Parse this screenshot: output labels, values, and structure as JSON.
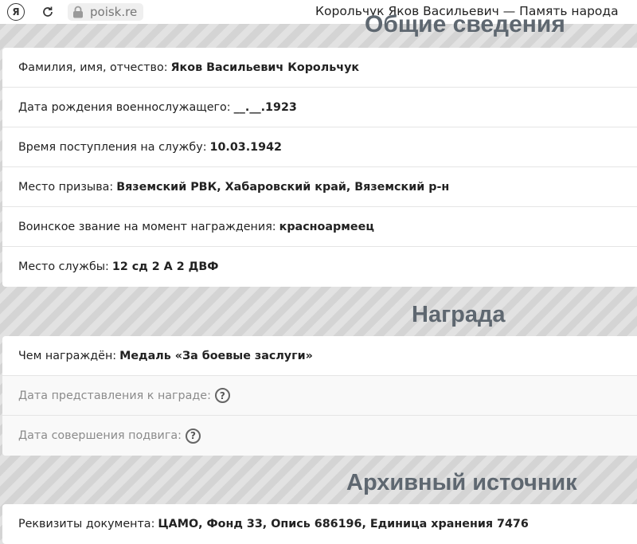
{
  "browser": {
    "yandex_label": "Я",
    "address": "poisk.re",
    "page_title": "Корольчук Яков Васильевич — Память народа"
  },
  "general": {
    "heading": "Общие сведения",
    "rows": [
      {
        "label": "Фамилия, имя, отчество:",
        "value": "Яков Васильевич Корольчук"
      },
      {
        "label": "Дата рождения военнослужащего:",
        "value": "__.__.1923"
      },
      {
        "label": "Время поступления на службу:",
        "value": "10.03.1942"
      },
      {
        "label": "Место призыва:",
        "value": "Вяземский РВК, Хабаровский край, Вяземский р-н"
      },
      {
        "label": "Воинское звание на момент награждения:",
        "value": "красноармеец"
      },
      {
        "label": "Место службы:",
        "value": "12 сд 2 А 2 ДВФ"
      }
    ]
  },
  "award": {
    "heading": "Награда",
    "rows": [
      {
        "label": "Чем награждён:",
        "value": "Медаль «За боевые заслуги»"
      },
      {
        "label": "Дата представления к награде:",
        "help": "?"
      },
      {
        "label": "Дата совершения подвига:",
        "help": "?"
      }
    ]
  },
  "archive": {
    "heading": "Архивный источник",
    "rows": [
      {
        "label": "Реквизиты документа:",
        "value": "ЦАМО, Фонд 33, Опись 686196, Единица хранения 7476"
      }
    ]
  }
}
